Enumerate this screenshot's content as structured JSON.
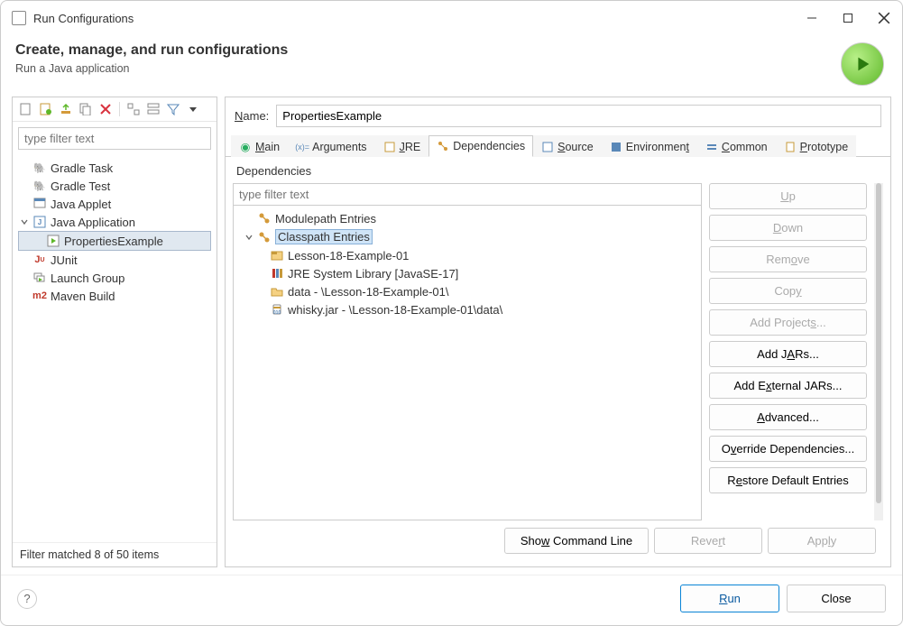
{
  "window_title": "Run Configurations",
  "header": {
    "title": "Create, manage, and run configurations",
    "subtitle": "Run a Java application"
  },
  "sidebar": {
    "filter_placeholder": "type filter text",
    "items": [
      {
        "label": "Gradle Task",
        "icon": "elephant"
      },
      {
        "label": "Gradle Test",
        "icon": "elephant"
      },
      {
        "label": "Java Applet",
        "icon": "applet"
      },
      {
        "label": "Java Application",
        "icon": "java-app",
        "expanded": true,
        "children": [
          {
            "label": "PropertiesExample",
            "icon": "java-run",
            "selected": true
          }
        ]
      },
      {
        "label": "JUnit",
        "icon": "junit"
      },
      {
        "label": "Launch Group",
        "icon": "launch-group"
      },
      {
        "label": "Maven Build",
        "icon": "maven"
      }
    ],
    "filter_status": "Filter matched 8 of 50 items"
  },
  "form": {
    "name_label": "Name:",
    "name_value": "PropertiesExample",
    "tabs": [
      {
        "label": "Main",
        "active": false
      },
      {
        "label": "Arguments",
        "active": false
      },
      {
        "label": "JRE",
        "active": false
      },
      {
        "label": "Dependencies",
        "active": true
      },
      {
        "label": "Source",
        "active": false
      },
      {
        "label": "Environment",
        "active": false
      },
      {
        "label": "Common",
        "active": false
      },
      {
        "label": "Prototype",
        "active": false
      }
    ],
    "dep_label": "Dependencies",
    "dep_filter_placeholder": "type filter text",
    "dep_tree": [
      {
        "label": "Modulepath Entries",
        "icon": "module",
        "expanded": false,
        "level": 0
      },
      {
        "label": "Classpath Entries",
        "icon": "module",
        "expanded": true,
        "selected": true,
        "level": 0,
        "children": [
          {
            "label": "Lesson-18-Example-01",
            "icon": "project"
          },
          {
            "label": "JRE System Library [JavaSE-17]",
            "icon": "library"
          },
          {
            "label": "data - \\Lesson-18-Example-01\\",
            "icon": "folder"
          },
          {
            "label": "whisky.jar - \\Lesson-18-Example-01\\data\\",
            "icon": "jar"
          }
        ]
      }
    ],
    "buttons": {
      "up": "Up",
      "down": "Down",
      "remove": "Remove",
      "copy": "Copy",
      "add_projects": "Add Projects...",
      "add_jars": "Add JARs...",
      "add_external_jars": "Add External JARs...",
      "advanced": "Advanced...",
      "override_deps": "Override Dependencies...",
      "restore_defaults": "Restore Default Entries"
    },
    "bottom": {
      "show_cmd": "Show Command Line",
      "revert": "Revert",
      "apply": "Apply"
    }
  },
  "footer": {
    "run": "Run",
    "close": "Close"
  }
}
